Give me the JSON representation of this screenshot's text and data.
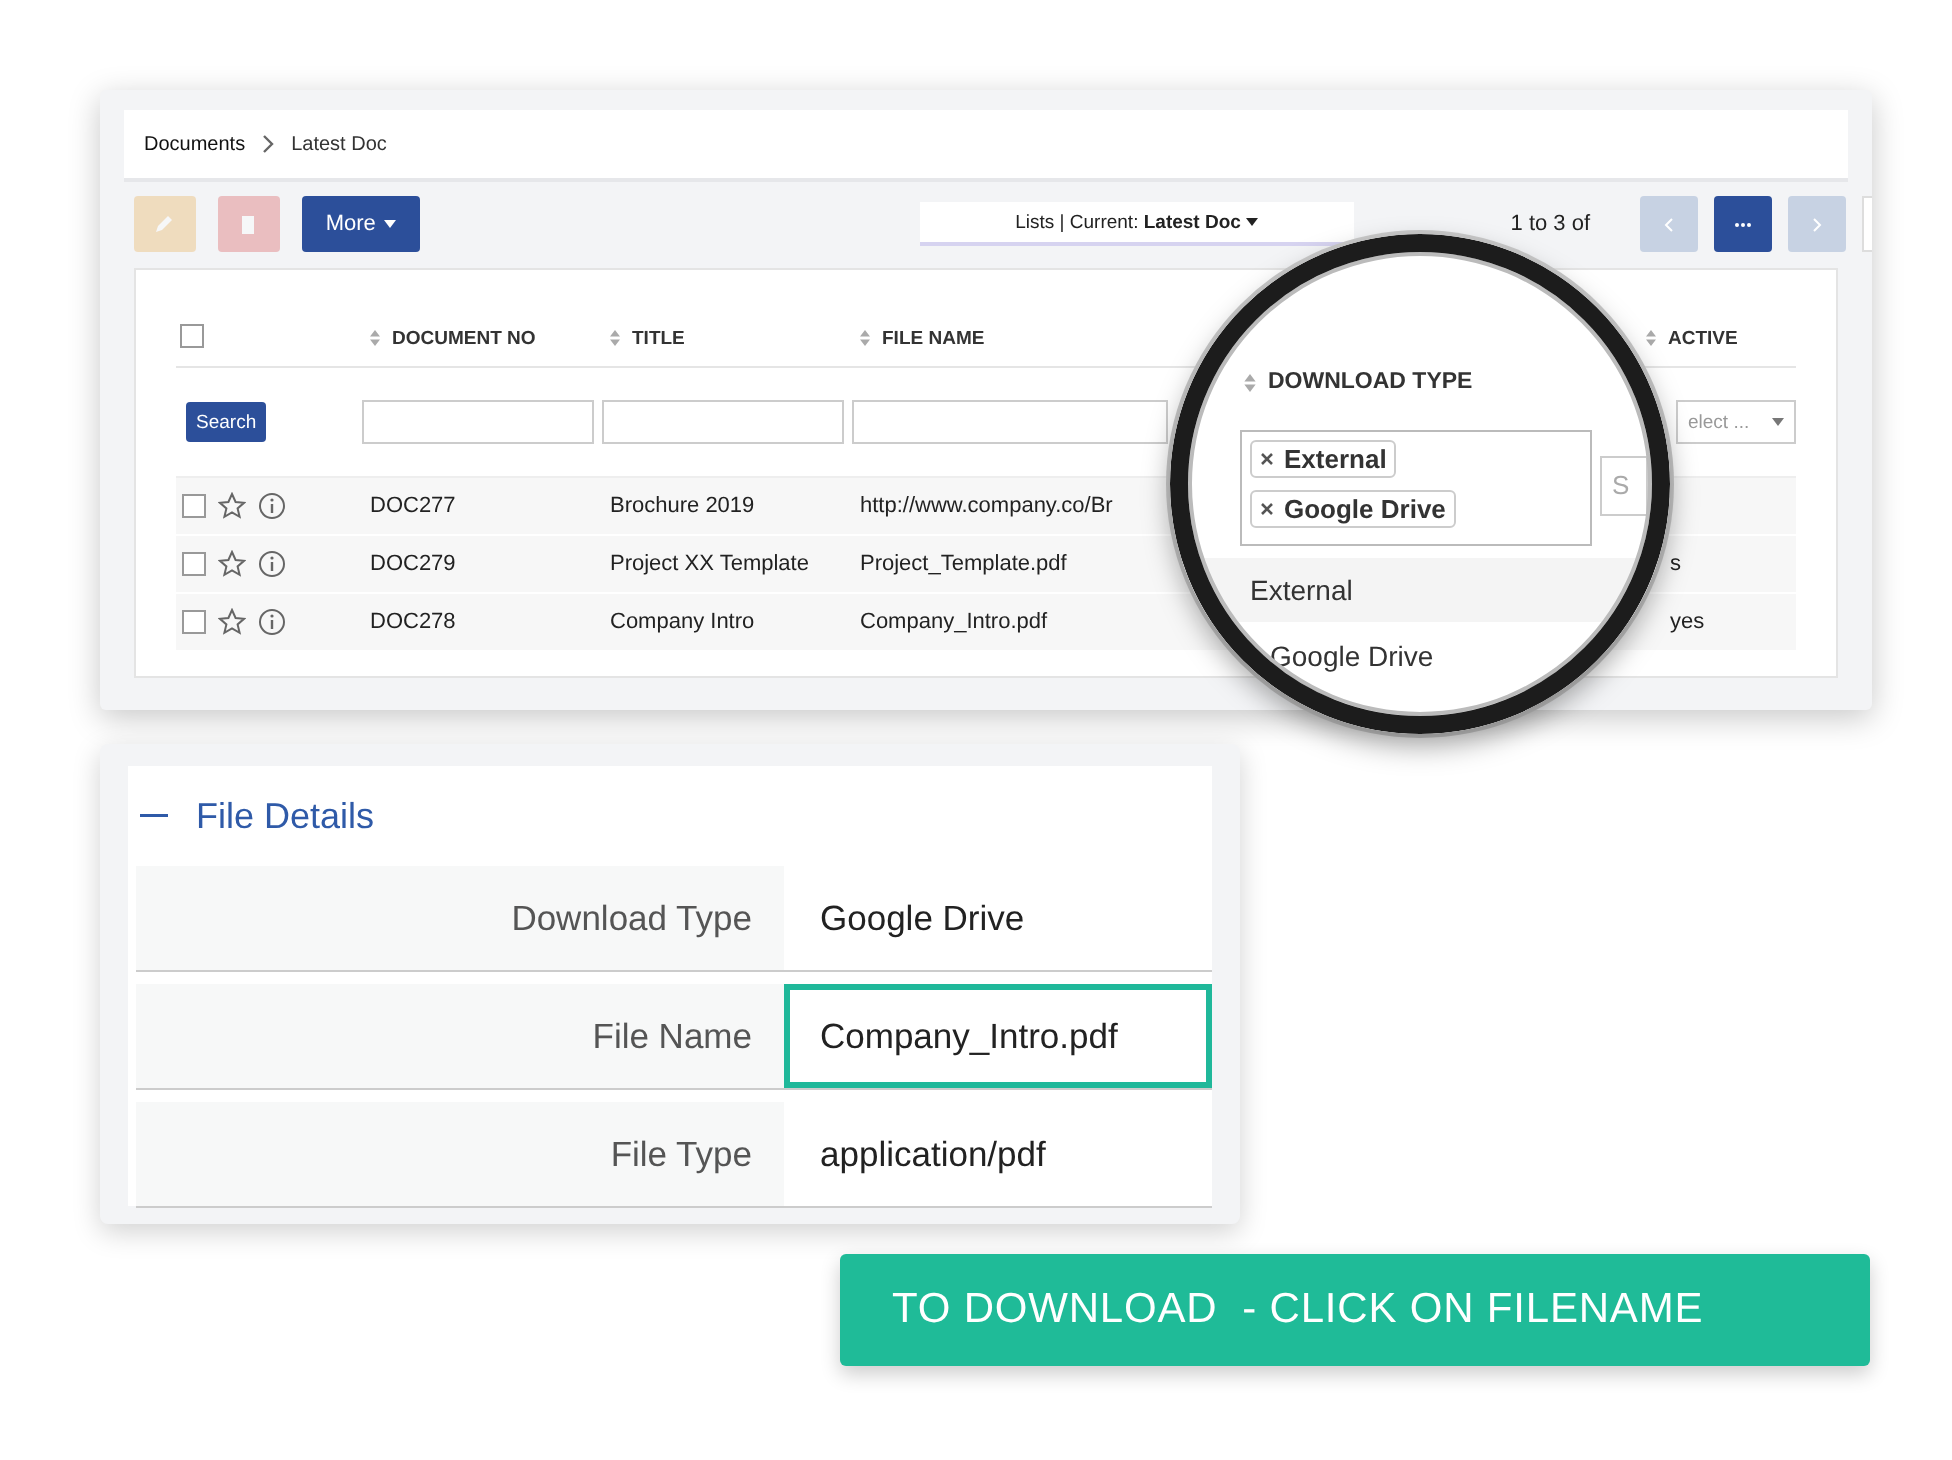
{
  "breadcrumb": [
    {
      "label": "Documents"
    },
    {
      "label": "Latest Doc"
    }
  ],
  "toolbar": {
    "buttons": [
      {
        "kind": "edit",
        "disabled": true
      },
      {
        "kind": "delete",
        "disabled": true
      },
      {
        "kind": "menu",
        "label": "More",
        "disabled": false
      }
    ],
    "list_selector": "Lists | Current: **Latest Doc**",
    "pagination": {
      "range": "1 to 3  of",
      "prev_disabled": true,
      "next_disabled": true
    }
  },
  "table": {
    "columns": [
      {
        "label": "DOCUMENT NO"
      },
      {
        "label": "TITLE"
      },
      {
        "label": "FILE NAME"
      },
      {
        "label": "ACTIVE"
      }
    ],
    "search_button": "Search",
    "active_filter_placeholder": "elect ...",
    "all_checked": false,
    "rows": [
      {
        "doc_no": "DOC277",
        "title": "Brochure 2019",
        "file_name": "http://www.company.co/Br",
        "checked": false,
        "starred": false
      },
      {
        "doc_no": "DOC279",
        "title": "Project XX Template",
        "file_name": "Project_Template.pdf",
        "active": "s",
        "checked": false,
        "starred": false
      },
      {
        "doc_no": "DOC278",
        "title": "Company Intro",
        "file_name": "Company_Intro.pdf",
        "active": "yes",
        "checked": false,
        "starred": false
      }
    ]
  },
  "magnifier": {
    "column": "DOWNLOAD TYPE",
    "tags": [
      "External",
      "Google Drive"
    ],
    "right_placeholder": "S",
    "rows": [
      {
        "value": "External"
      },
      {
        "value": "Google Drive"
      }
    ]
  },
  "file_details": {
    "title": "File Details",
    "expanded": true,
    "rows": [
      {
        "label": "Download Type",
        "value": "Google Drive",
        "highlighted": false
      },
      {
        "label": "File Name",
        "value": "Company_Intro.pdf",
        "highlighted": true
      },
      {
        "label": "File Type",
        "value": "application/pdf",
        "highlighted": false
      }
    ]
  },
  "banner": {
    "text": "TO DOWNLOAD  - CLICK ON FILENAME"
  }
}
